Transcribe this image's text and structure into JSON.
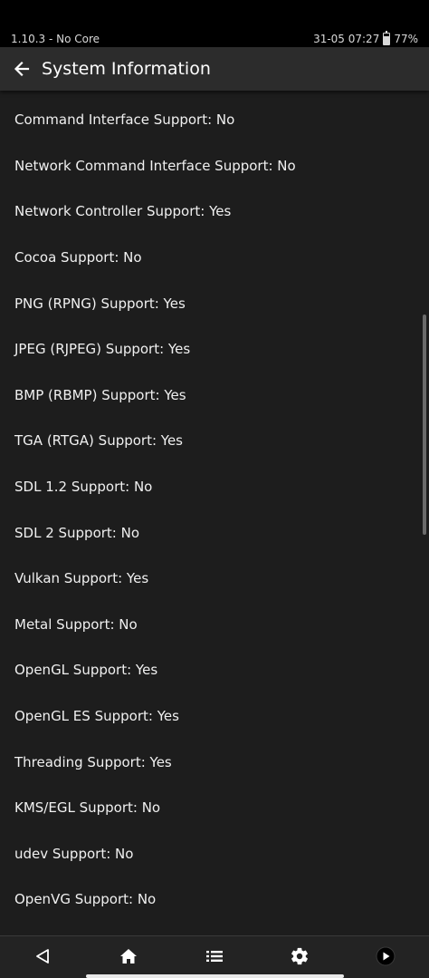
{
  "status_bar": {
    "app_version": "1.10.3 - No Core",
    "datetime": "31-05 07:27",
    "battery": "77%",
    "battery_level": 0.77
  },
  "header": {
    "title": "System Information",
    "back_icon": "arrow-left-icon"
  },
  "items": [
    {
      "label": "Command Interface Support: No"
    },
    {
      "label": "Network Command Interface Support: No"
    },
    {
      "label": "Network Controller Support: Yes"
    },
    {
      "label": "Cocoa Support: No"
    },
    {
      "label": "PNG (RPNG) Support: Yes"
    },
    {
      "label": "JPEG (RJPEG) Support: Yes"
    },
    {
      "label": "BMP (RBMP) Support: Yes"
    },
    {
      "label": "TGA (RTGA) Support: Yes"
    },
    {
      "label": "SDL 1.2 Support: No"
    },
    {
      "label": "SDL 2 Support: No"
    },
    {
      "label": "Vulkan Support: Yes"
    },
    {
      "label": "Metal Support: No"
    },
    {
      "label": "OpenGL Support: Yes"
    },
    {
      "label": "OpenGL ES Support: Yes"
    },
    {
      "label": "Threading Support: Yes"
    },
    {
      "label": "KMS/EGL Support: No"
    },
    {
      "label": "udev Support: No"
    },
    {
      "label": "OpenVG Support: No"
    }
  ],
  "bottom_nav": [
    {
      "icon": "back-triangle-icon"
    },
    {
      "icon": "home-icon"
    },
    {
      "icon": "list-icon"
    },
    {
      "icon": "gear-icon"
    },
    {
      "icon": "play-circle-icon"
    }
  ],
  "colors": {
    "background": "#1d1d1d",
    "header": "#2c2c2c",
    "nav": "#232323",
    "text": "#f0f0f0"
  }
}
